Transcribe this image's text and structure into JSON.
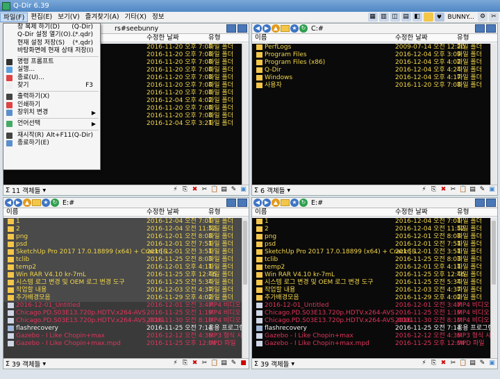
{
  "window": {
    "title": "Q-Dir 6.39"
  },
  "menu": {
    "items": [
      "파일(F)",
      "편집(E)",
      "보기(V)",
      "즐겨찾기(A)",
      "기타(X)",
      "정보"
    ],
    "right_label": "BUNNY..."
  },
  "file_menu": [
    {
      "label": "창 복제 하기(D)",
      "shortcut": "(Q-Dir)"
    },
    {
      "label": "Q-Dir 설정 열기(O)...",
      "shortcut": "(*.qdr)"
    },
    {
      "label": "현재 설정 저장(S)",
      "shortcut": "(*.qdr)"
    },
    {
      "label": "바탕화면에 현재 상태 저장(I)",
      "shortcut": ""
    },
    {
      "sep": true
    },
    {
      "label": "명령 프롬프트",
      "shortcut": ""
    },
    {
      "label": "실행...",
      "shortcut": ""
    },
    {
      "label": "종료(U)...",
      "shortcut": ""
    },
    {
      "label": "찾기",
      "shortcut": "F3"
    },
    {
      "sep": true
    },
    {
      "label": "출력하기(X)",
      "shortcut": ""
    },
    {
      "label": "인쇄하기",
      "shortcut": ""
    },
    {
      "label": "창위치 변경",
      "shortcut": "",
      "submenu": true
    },
    {
      "sep": true
    },
    {
      "label": "언어선택",
      "shortcut": "",
      "submenu": true
    },
    {
      "sep": true
    },
    {
      "label": "재시작(R)",
      "shortcut": "Alt+F11(Q-Dir)"
    },
    {
      "label": "종료하기(E)",
      "shortcut": ""
    }
  ],
  "columns": {
    "name": "이름",
    "date": "수정한 날짜",
    "type": "유형"
  },
  "panes": [
    {
      "id": "tl",
      "path": "rs#seebunny",
      "status": "11 객체들",
      "rows": [
        {
          "name": "",
          "date": "2016-11-20 오후 7:08",
          "type": "파일 폴더",
          "kind": "dir"
        },
        {
          "name": "",
          "date": "2016-11-20 오후 7:08",
          "type": "파일 폴더",
          "kind": "dir"
        },
        {
          "name": "",
          "date": "2016-11-20 오후 7:08",
          "type": "파일 폴더",
          "kind": "dir"
        },
        {
          "name": "",
          "date": "2016-11-20 오후 7:08",
          "type": "파일 폴더",
          "kind": "dir"
        },
        {
          "name": "",
          "date": "2016-11-20 오후 7:08",
          "type": "파일 폴더",
          "kind": "dir"
        },
        {
          "name": "",
          "date": "2016-11-20 오후 7:08",
          "type": "파일 폴더",
          "kind": "dir"
        },
        {
          "name": "",
          "date": "2016-11-20 오후 7:08",
          "type": "파일 폴더",
          "kind": "dir"
        },
        {
          "name": "",
          "date": "2016-12-04 오후 4:02",
          "type": "파일 폴더",
          "kind": "dir"
        },
        {
          "name": "",
          "date": "2016-11-20 오후 7:08",
          "type": "파일 폴더",
          "kind": "dir"
        },
        {
          "name": "",
          "date": "2016-11-20 오후 7:08",
          "type": "파일 폴더",
          "kind": "dir"
        },
        {
          "name": "",
          "date": "2016-12-04 오후 3:21",
          "type": "파일 폴더",
          "kind": "dir"
        }
      ]
    },
    {
      "id": "tr",
      "path": "C:#",
      "status": "6 객체들",
      "rows": [
        {
          "name": "PerfLogs",
          "date": "2009-07-14 오전 12:20",
          "type": "파일 폴더",
          "kind": "dir"
        },
        {
          "name": "Program Files",
          "date": "2016-12-04 오후 3:09",
          "type": "파일 폴더",
          "kind": "dir"
        },
        {
          "name": "Program Files (x86)",
          "date": "2016-12-04 오후 4:02",
          "type": "파일 폴더",
          "kind": "dir"
        },
        {
          "name": "Q-Dir",
          "date": "2016-12-04 오후 4:24",
          "type": "파일 폴더",
          "kind": "dir"
        },
        {
          "name": "Windows",
          "date": "2016-12-04 오후 4:17",
          "type": "파일 폴더",
          "kind": "dir"
        },
        {
          "name": "사용자",
          "date": "2016-11-20 오후 7:08",
          "type": "파일 폴더",
          "kind": "dir"
        }
      ]
    },
    {
      "id": "bl",
      "path": "E:#",
      "status": "39 객체들",
      "rows": [
        {
          "name": "1",
          "date": "2016-12-04 오전 7:01",
          "type": "파일 폴더",
          "kind": "dir"
        },
        {
          "name": "2",
          "date": "2016-12-04 오전 11:52",
          "type": "파일 폴더",
          "kind": "dir"
        },
        {
          "name": "png",
          "date": "2016-12-01 오전 8:08",
          "type": "파일 폴더",
          "kind": "dir"
        },
        {
          "name": "psd",
          "date": "2016-12-01 오전 7:51",
          "type": "파일 폴더",
          "kind": "dir"
        },
        {
          "name": "SketchUp Pro 2017 17.0.18899 (x64) + Crack [S...",
          "date": "2016-12-01 오전 3:51",
          "type": "파일 폴더",
          "kind": "dir"
        },
        {
          "name": "tclib",
          "date": "2016-11-25 오전 8:03",
          "type": "파일 폴더",
          "kind": "dir"
        },
        {
          "name": "temp2",
          "date": "2016-12-01 오후 4:11",
          "type": "파일 폴더",
          "kind": "dir"
        },
        {
          "name": "Win RAR V4.10 kr-7mL",
          "date": "2016-11-25 오후 12:46",
          "type": "파일 폴더",
          "kind": "dir"
        },
        {
          "name": "시스템 로그 변경 및 OEM 로그 변경 도구",
          "date": "2016-11-25 오전 5:34",
          "type": "파일 폴더",
          "kind": "dir"
        },
        {
          "name": "작업할 내용",
          "date": "2016-12-03 오전 4:37",
          "type": "파일 폴더",
          "kind": "dir"
        },
        {
          "name": "추가배경모음",
          "date": "2016-11-29 오후 4:02",
          "type": "파일 폴더",
          "kind": "dir"
        },
        {
          "name": "2016-12-01_Untitled",
          "date": "2016-12-01 오전 3:47",
          "type": "MP4 비디오",
          "kind": "mp4"
        },
        {
          "name": "Chicago.PD.S03E13.720p.HDTV.x264-AVS",
          "date": "2016-11-25 오전 1:19",
          "type": "MP4 비디오",
          "kind": "mp4"
        },
        {
          "name": "Chicago.PD.S03E13.720p.HDTV.x264-AVS_0001",
          "date": "2016-11-30 오전 8:10",
          "type": "MP4 비디오",
          "kind": "mp4"
        },
        {
          "name": "flashrecovery",
          "date": "2016-11-25 오전 7:14",
          "type": "응용 프로그램",
          "kind": "exe"
        },
        {
          "name": "Gazebo - I Like Chopin+max",
          "date": "2016-12-12 오전 4:36",
          "type": "MP3 형식 사",
          "kind": "mp4"
        },
        {
          "name": "Gazebo - I Like Chopin+max.mpd",
          "date": "2016-11-25 오후 12:04",
          "type": "MPD 파일",
          "kind": "mp4"
        }
      ]
    },
    {
      "id": "br",
      "path": "E:#",
      "status": "39 객체들",
      "rows": [
        {
          "name": "1",
          "date": "2016-12-04 오전 7:01",
          "type": "파일 폴더",
          "kind": "dir"
        },
        {
          "name": "2",
          "date": "2016-12-04 오전 11:52",
          "type": "파일 폴더",
          "kind": "dir"
        },
        {
          "name": "png",
          "date": "2016-12-01 오전 8:08",
          "type": "파일 폴더",
          "kind": "dir"
        },
        {
          "name": "psd",
          "date": "2016-12-01 오전 7:51",
          "type": "파일 폴더",
          "kind": "dir"
        },
        {
          "name": "SketchUp Pro 2017 17.0.18899 (x64) + Crack [S...",
          "date": "2016-12-01 오전 3:51",
          "type": "파일 폴더",
          "kind": "dir"
        },
        {
          "name": "tclib",
          "date": "2016-11-25 오전 8:03",
          "type": "파일 폴더",
          "kind": "dir"
        },
        {
          "name": "temp2",
          "date": "2016-12-01 오후 4:11",
          "type": "파일 폴더",
          "kind": "dir"
        },
        {
          "name": "Win RAR V4.10 kr-7mL",
          "date": "2016-11-25 오후 12:46",
          "type": "파일 폴더",
          "kind": "dir"
        },
        {
          "name": "시스템 로그 변경 및 OEM 로그 변경 도구",
          "date": "2016-11-25 오전 5:34",
          "type": "파일 폴더",
          "kind": "dir"
        },
        {
          "name": "작업할 내용",
          "date": "2016-12-03 오전 4:37",
          "type": "파일 폴더",
          "kind": "dir"
        },
        {
          "name": "추가배경모음",
          "date": "2016-11-29 오후 4:02",
          "type": "파일 폴더",
          "kind": "dir"
        },
        {
          "name": "2016-12-01_Untitled",
          "date": "2016-12-01 오전 3:47",
          "type": "MP4 비디오",
          "kind": "mp4"
        },
        {
          "name": "Chicago.PD.S03E13.720p.HDTV.x264-AVS",
          "date": "2016-11-25 오전 1:19",
          "type": "MP4 비디오",
          "kind": "mp4"
        },
        {
          "name": "Chicago.PD.S03E13.720p.HDTV.x264-AVS_0001",
          "date": "2016-11-30 오전 8:10",
          "type": "MP4 비디오",
          "kind": "mp4"
        },
        {
          "name": "flashrecovery",
          "date": "2016-11-25 오전 7:14",
          "type": "응용 프로그램",
          "kind": "exe"
        },
        {
          "name": "Gazebo - I Like Chopin+max",
          "date": "2016-12-12 오전 4:36",
          "type": "MP3 형식 사",
          "kind": "mp4"
        },
        {
          "name": "Gazebo - I Like Chopin+max.mpd",
          "date": "2016-11-25 오후 12:04",
          "type": "MPD 파일",
          "kind": "mp4"
        }
      ]
    }
  ],
  "colors": {
    "folder_text": "#f2d64b",
    "video_text": "#e0345a",
    "list_bg": "#0a0a0a",
    "title_bar": "#5a8fcc"
  }
}
